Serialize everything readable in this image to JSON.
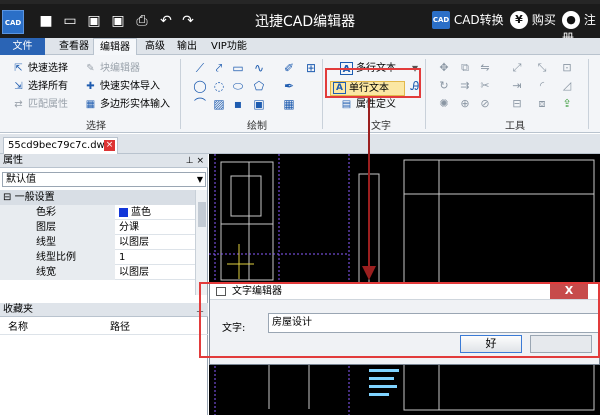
{
  "window": {
    "title": "迅捷CAD编辑器",
    "logo_text": "CAD",
    "cad_convert": "CAD转换",
    "buy": "购买",
    "register": "注册"
  },
  "menubar": {
    "items": [
      "文件",
      "查看器",
      "编辑器",
      "高级",
      "输出",
      "VIP功能"
    ],
    "active": "编辑器"
  },
  "ribbon": {
    "select_group": {
      "label": "选择",
      "items": [
        "快速选择",
        "选择所有",
        "匹配属性",
        "块编辑器",
        "快速实体导入",
        "多边形实体输入"
      ]
    },
    "draw_group": {
      "label": "绘制"
    },
    "text_group": {
      "label": "文字",
      "items": [
        "多行文本",
        "单行文本",
        "属性定义"
      ]
    },
    "tools_group": {
      "label": "工具"
    }
  },
  "doc_tab": {
    "filename": "55cd9bec79c7c.dwg",
    "close": "×"
  },
  "properties": {
    "title": "属性",
    "combo_value": "默认值",
    "section": "一般设置",
    "rows": [
      {
        "key": "色彩",
        "value": "蓝色"
      },
      {
        "key": "图层",
        "value": "分课"
      },
      {
        "key": "线型",
        "value": "以图层"
      },
      {
        "key": "线型比例",
        "value": "1"
      },
      {
        "key": "线宽",
        "value": "以图层"
      }
    ],
    "accent_color": "#1236d9"
  },
  "favorites": {
    "title": "收藏夹",
    "columns": [
      "名称",
      "路径"
    ]
  },
  "dialog": {
    "title": "文字编辑器",
    "label": "文字:",
    "value": "房屋设计",
    "ok": "好",
    "close": "X"
  },
  "colors": {
    "highlight": "#e23b3b",
    "titlebar": "#1b1b1b",
    "file_menu": "#2a64b5"
  }
}
